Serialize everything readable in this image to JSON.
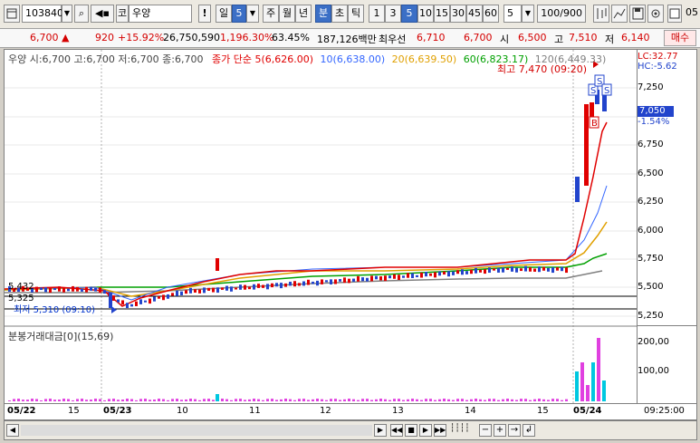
{
  "toolbar": {
    "code": "103840",
    "market_tag": "코",
    "name": "우양",
    "excl": "!",
    "period_days": [
      "일",
      "주",
      "월",
      "년",
      "분",
      "초",
      "틱"
    ],
    "period_day_count": "5",
    "minute_buttons": [
      "1",
      "3",
      "5",
      "10",
      "15",
      "30",
      "45",
      "60"
    ],
    "active_minute": "5",
    "interval_value": "5",
    "count_display": "100/900",
    "right_tail": "05"
  },
  "infobar": {
    "price": "6,700",
    "change": "920",
    "change_pct": "+15.92%",
    "volume": "26,750,590",
    "volume_ratio": "1,196.30%",
    "turnover_ratio": "63.45%",
    "amount": "187,126백만",
    "best_ask_label": "최우선",
    "best_ask": "6,710",
    "best_bid": "6,700",
    "open_label": "시",
    "open": "6,500",
    "high_label": "고",
    "high": "7,510",
    "low_label": "저",
    "low": "6,140",
    "order_label": "매수"
  },
  "price_legend": {
    "name": "우양 시:6,700 고:6,700 저:6,700 종:6,700",
    "close_simple": "종가 단순 5(6,626.00)",
    "ma10": "10(6,638.00)",
    "ma20": "20(6,639.50)",
    "ma60": "60(6,823.17)",
    "ma120": "120(6,449.33)",
    "colors": {
      "ma5": "#e00000",
      "ma10": "#3366ff",
      "ma20": "#e0a000",
      "ma60": "#00a000",
      "ma120": "#808080"
    }
  },
  "annotations": {
    "high_marker": "최고 7,470 (09:20)",
    "low_marker": "최저 5,310 (09:10)",
    "lc": "LC:32.77",
    "hc": "HC:-5.62",
    "current_price": "7,050",
    "current_change": "-1.54%",
    "level_a": "5,432",
    "level_b": "5,325"
  },
  "yaxis_price_ticks": [
    "7,250",
    "7,000",
    "6,750",
    "6,500",
    "6,250",
    "6,000",
    "5,750",
    "5,500",
    "5,250"
  ],
  "volume_legend": "분봉거래대금[0](15,69)",
  "yaxis_volume_ticks": [
    "200,00",
    "100,00"
  ],
  "xaxis_labels": [
    "05/22",
    "15",
    "05/23",
    "10",
    "11",
    "12",
    "13",
    "14",
    "15",
    "05/24"
  ],
  "xaxis_time": "09:25:00",
  "signal_markers": [
    "S",
    "S",
    "S",
    "B"
  ]
}
